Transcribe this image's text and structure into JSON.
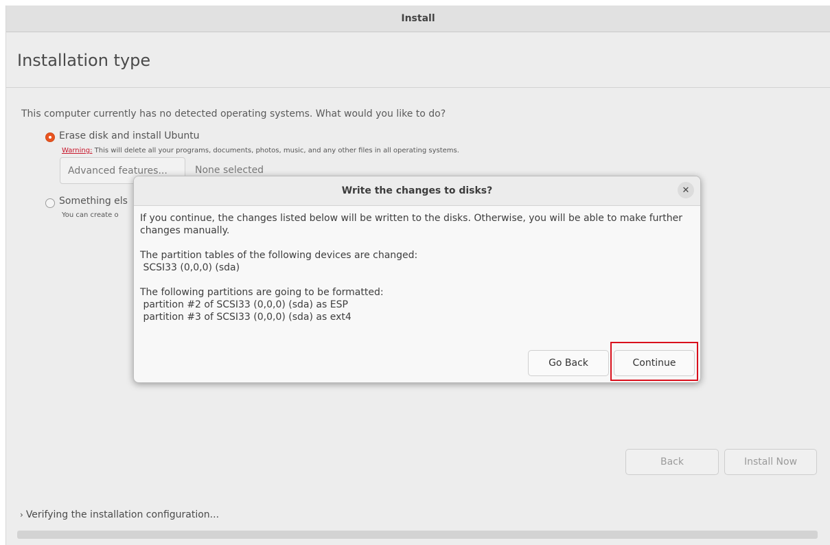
{
  "window": {
    "title": "Install"
  },
  "page": {
    "title": "Installation type",
    "question": "This computer currently has no detected operating systems. What would you like to do?"
  },
  "options": {
    "erase": {
      "label": "Erase disk and install Ubuntu",
      "selected": true,
      "warning_prefix": "Warning:",
      "warning_text": " This will delete all your programs, documents, photos, music, and any other files in all operating systems.",
      "advanced_button": "Advanced features...",
      "advanced_value": "None selected"
    },
    "something_else": {
      "label": "Something els",
      "selected": false,
      "sub": "You can create o"
    }
  },
  "nav": {
    "back": "Back",
    "install_now": "Install Now"
  },
  "progress": {
    "label": "Verifying the installation configuration..."
  },
  "dialog": {
    "title": "Write the changes to disks?",
    "intro": "If you continue, the changes listed below will be written to the disks. Otherwise, you will be able to make further changes manually.",
    "tables_header": "The partition tables of the following devices are changed:",
    "tables_items": [
      " SCSI33 (0,0,0) (sda)"
    ],
    "format_header": "The following partitions are going to be formatted:",
    "format_items": [
      " partition #2 of SCSI33 (0,0,0) (sda) as ESP",
      " partition #3 of SCSI33 (0,0,0) (sda) as ext4"
    ],
    "go_back": "Go Back",
    "continue": "Continue",
    "close_icon": "close-icon"
  },
  "colors": {
    "accent": "#e95420",
    "highlight": "#d9101c",
    "warning": "#c7162b"
  }
}
